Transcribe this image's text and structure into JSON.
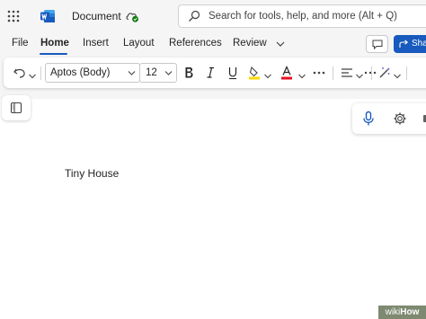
{
  "titlebar": {
    "doc_title": "Document",
    "search_placeholder": "Search for tools, help, and more (Alt + Q)",
    "app": "word",
    "icons": [
      "app-launcher-icon",
      "word-logo-icon",
      "cloud-saved-icon",
      "search-icon"
    ]
  },
  "ribbon": {
    "tabs": [
      {
        "label": "File"
      },
      {
        "label": "Home",
        "active": true
      },
      {
        "label": "Insert"
      },
      {
        "label": "Layout"
      },
      {
        "label": "References"
      },
      {
        "label": "Review"
      }
    ],
    "share_label": "Sha"
  },
  "toolbar": {
    "font_name": "Aptos (Body)",
    "font_size": "12",
    "icons": [
      "undo-icon",
      "bold-icon",
      "italic-icon",
      "underline-icon",
      "highlight-icon",
      "font-color-icon",
      "more-icon",
      "align-icon",
      "more-icon",
      "styles-icon"
    ]
  },
  "document": {
    "body_text": "Tiny House"
  },
  "floating": {
    "icons": [
      "microphone-icon",
      "settings-icon"
    ]
  },
  "watermark": {
    "brand_part1": "wiki",
    "brand_part2": "How"
  },
  "colors": {
    "accent": "#185abd",
    "titlebar_bg": "#f5f5f5",
    "highlight_yellow": "#ffd700",
    "font_color_red": "#e81123",
    "mic_blue": "#185abd"
  }
}
